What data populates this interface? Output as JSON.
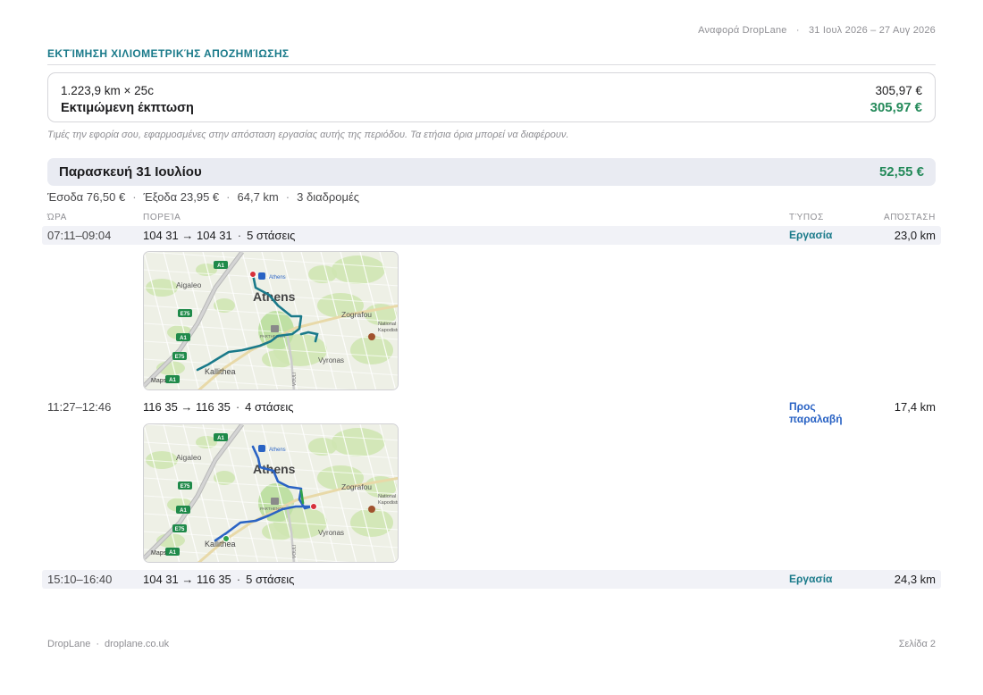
{
  "report": {
    "title": "Αναφορά DropLane",
    "separator": "·",
    "period": "31 Ιουλ 2026 – 27 Αυγ 2026"
  },
  "section": {
    "title": "ΕΚΤΊΜΗΣΗ ΧΙΛΙΟΜΕΤΡΙΚΉΣ ΑΠΟΖΗΜΊΩΣΗΣ"
  },
  "summary": {
    "calc": "1.223,9 km × 25c",
    "calc_amount": "305,97 €",
    "deduction_label": "Εκτιμώμενη έκπτωση",
    "deduction_amount": "305,97 €"
  },
  "note": "Τιμές την εφορία σου, εφαρμοσμένες στην απόσταση εργασίας αυτής της περιόδου. Τα ετήσια όρια μπορεί να διαφέρουν.",
  "day": {
    "title": "Παρασκευή 31 Ιουλίου",
    "total": "52,55 €",
    "stats": [
      "Έσοδα 76,50 €",
      "Έξοδα 23,95 €",
      "64,7 km",
      "3 διαδρομές"
    ],
    "separator": "·"
  },
  "columns": {
    "time": "ΏΡΑ",
    "route": "ΠΟΡΕΊΑ",
    "type": "ΤΎΠΟΣ",
    "distance": "ΑΠΌΣΤΑΣΗ"
  },
  "trips": [
    {
      "time": "07:11–09:04",
      "route": "104 31 → 104 31",
      "dot": "·",
      "stops": "5 στάσεις",
      "type": "Εργασία",
      "distance": "23,0 km",
      "route_color": "#1a7a8a"
    },
    {
      "time": "11:27–12:46",
      "route": "116 35 → 116 35",
      "dot": "·",
      "stops": "4 στάσεις",
      "type_line1": "Προς",
      "type_line2": "παραλαβή",
      "distance": "17,4 km",
      "route_color": "#2a63c4"
    },
    {
      "time": "15:10–16:40",
      "route": "104 31 → 116 35",
      "dot": "·",
      "stops": "5 στάσεις",
      "type": "Εργασία",
      "distance": "24,3 km"
    }
  ],
  "map_labels": {
    "city": "Athens",
    "pin": "Athens",
    "aigaleo": "Aigaleo",
    "zografou": "Zografou",
    "kallithea": "Kallithea",
    "vyronas": "Vyronas",
    "parthenon": "PARTHENON",
    "university": "National Kapodistrian University of Athens ELKE Center",
    "hwy_a1": "A1",
    "hwy_e75": "E75",
    "attribution": "Maps",
    "vouliagmenis": "VOULI"
  },
  "footer": {
    "brand": "DropLane",
    "separator": "·",
    "url": "droplane.co.uk",
    "page": "Σελίδα 2"
  }
}
